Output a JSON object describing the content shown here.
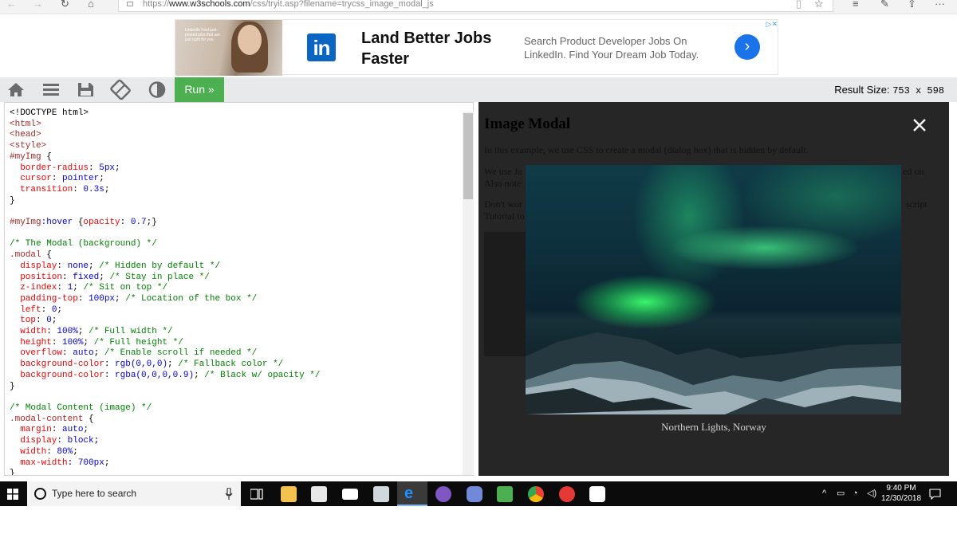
{
  "browser": {
    "url_prefix": "https://",
    "url_domain": "www.w3schools.com",
    "url_path": "/css/tryit.asp?filename=trycss_image_modal_js"
  },
  "ad": {
    "photo_text": "LinkedIn  Find just-posted jobs that are just right for you",
    "logo_text": "in",
    "headline": "Land Better Jobs Faster",
    "copy": "Search Product Developer Jobs On LinkedIn. Find Your Dream Job Today.",
    "arrow": "›",
    "adchoices": "▷✕"
  },
  "toolbar": {
    "run_label": "Run »",
    "result_label": "Result Size:",
    "result_dims": "753 x 598"
  },
  "result": {
    "title": "Image Modal",
    "p1": "In this example, we use CSS to create a modal (dialog box) that is hidden by default.",
    "p2a": "We use Ja",
    "p2b": "ed on.",
    "p2c": "Also note",
    "p3a": "Don't wor",
    "p3b": "script",
    "p3c": "Tutorial to",
    "caption": "Northern Lights, Norway"
  },
  "taskbar": {
    "search_placeholder": "Type here to search",
    "time": "9:40 PM",
    "date": "12/30/2018"
  },
  "colors": {
    "run_green": "#4caf50",
    "linkedin_blue": "#0a66c2",
    "result_bg": "#262626"
  }
}
